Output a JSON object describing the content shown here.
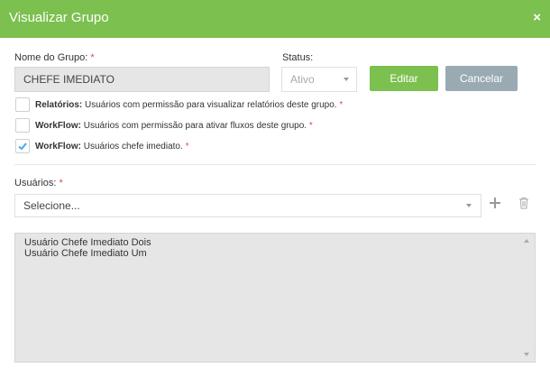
{
  "header": {
    "title": "Visualizar Grupo",
    "close_symbol": "×"
  },
  "form": {
    "group_name_label": "Nome do Grupo:",
    "required_mark": "*",
    "group_name_value": "CHEFE IMEDIATO",
    "status_label": "Status:",
    "status_value": "Ativo",
    "edit_label": "Editar",
    "cancel_label": "Cancelar"
  },
  "permissions": [
    {
      "bold": "Relatórios:",
      "text": "Usuários com permissão para visualizar relatórios deste grupo.",
      "checked": false
    },
    {
      "bold": "WorkFlow:",
      "text": "Usuários com permissão para ativar fluxos deste grupo.",
      "checked": false
    },
    {
      "bold": "WorkFlow:",
      "text": "Usuários chefe imediato.",
      "checked": true
    }
  ],
  "users": {
    "label": "Usuários:",
    "select_placeholder": "Selecione...",
    "list": [
      "Usuário Chefe Imediato Dois",
      "Usuário Chefe Imediato Um"
    ]
  },
  "colors": {
    "accent": "#7cc04f",
    "cancel": "#99aab3",
    "check": "#3fa9f5",
    "required": "#e24a4a"
  }
}
